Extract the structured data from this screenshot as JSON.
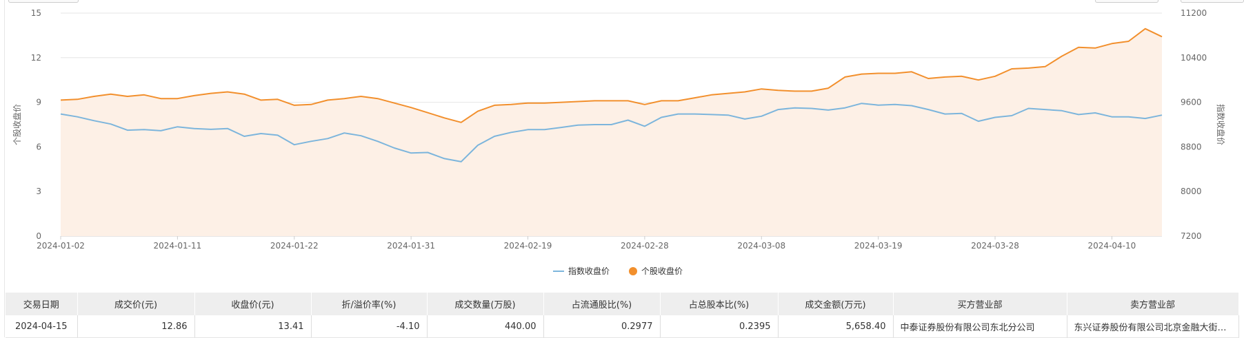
{
  "chart_data": {
    "type": "line",
    "x": [
      "2024-01-02",
      "2024-01-03",
      "2024-01-04",
      "2024-01-05",
      "2024-01-08",
      "2024-01-09",
      "2024-01-10",
      "2024-01-11",
      "2024-01-12",
      "2024-01-15",
      "2024-01-16",
      "2024-01-17",
      "2024-01-18",
      "2024-01-19",
      "2024-01-22",
      "2024-01-23",
      "2024-01-24",
      "2024-01-25",
      "2024-01-26",
      "2024-01-29",
      "2024-01-30",
      "2024-01-31",
      "2024-02-01",
      "2024-02-02",
      "2024-02-05",
      "2024-02-06",
      "2024-02-07",
      "2024-02-08",
      "2024-02-19",
      "2024-02-20",
      "2024-02-21",
      "2024-02-22",
      "2024-02-23",
      "2024-02-26",
      "2024-02-27",
      "2024-02-28",
      "2024-02-29",
      "2024-03-01",
      "2024-03-04",
      "2024-03-05",
      "2024-03-06",
      "2024-03-07",
      "2024-03-08",
      "2024-03-11",
      "2024-03-12",
      "2024-03-13",
      "2024-03-14",
      "2024-03-15",
      "2024-03-18",
      "2024-03-19",
      "2024-03-20",
      "2024-03-21",
      "2024-03-22",
      "2024-03-25",
      "2024-03-26",
      "2024-03-27",
      "2024-03-28",
      "2024-03-29",
      "2024-04-01",
      "2024-04-02",
      "2024-04-03",
      "2024-04-08",
      "2024-04-09",
      "2024-04-10",
      "2024-04-11",
      "2024-04-12",
      "2024-04-15"
    ],
    "x_ticks": [
      "2024-01-02",
      "2024-01-11",
      "2024-01-22",
      "2024-01-31",
      "2024-02-19",
      "2024-02-28",
      "2024-03-08",
      "2024-03-19",
      "2024-03-28",
      "2024-04-10"
    ],
    "series": [
      {
        "name": "指数收盘价",
        "axis": "right",
        "color": "#7cb5dc",
        "style": "line",
        "values": [
          9390,
          9340,
          9270,
          9210,
          9100,
          9110,
          9090,
          9160,
          9130,
          9115,
          9130,
          8990,
          9040,
          9010,
          8840,
          8900,
          8950,
          9050,
          9000,
          8900,
          8780,
          8690,
          8700,
          8590,
          8535,
          8830,
          8990,
          9060,
          9110,
          9110,
          9150,
          9190,
          9200,
          9200,
          9280,
          9170,
          9330,
          9390,
          9390,
          9380,
          9370,
          9300,
          9350,
          9470,
          9500,
          9490,
          9460,
          9500,
          9580,
          9550,
          9560,
          9540,
          9470,
          9390,
          9400,
          9260,
          9330,
          9360,
          9490,
          9470,
          9450,
          9380,
          9410,
          9340,
          9340,
          9310,
          9370
        ]
      },
      {
        "name": "个股收盘价",
        "axis": "left",
        "color": "#f28f2c",
        "fill": "#fdf0e6",
        "style": "area",
        "values": [
          9.15,
          9.2,
          9.4,
          9.55,
          9.4,
          9.5,
          9.25,
          9.25,
          9.45,
          9.6,
          9.7,
          9.55,
          9.15,
          9.2,
          8.8,
          8.85,
          9.15,
          9.25,
          9.4,
          9.25,
          8.95,
          8.65,
          8.3,
          7.95,
          7.65,
          8.4,
          8.8,
          8.85,
          8.95,
          8.95,
          9.0,
          9.05,
          9.1,
          9.1,
          9.1,
          8.85,
          9.1,
          9.1,
          9.3,
          9.5,
          9.6,
          9.7,
          9.9,
          9.8,
          9.75,
          9.75,
          9.95,
          10.7,
          10.9,
          10.95,
          10.95,
          11.05,
          10.6,
          10.7,
          10.75,
          10.5,
          10.75,
          11.25,
          11.3,
          11.4,
          12.1,
          12.7,
          12.65,
          12.95,
          13.1,
          13.95,
          13.41
        ]
      }
    ],
    "y_left": {
      "label": "个股收盘价",
      "range": [
        0,
        15
      ],
      "ticks": [
        0,
        3,
        6,
        9,
        12,
        15
      ]
    },
    "y_right": {
      "label": "指数收盘价",
      "range": [
        7200,
        11200
      ],
      "ticks": [
        7200,
        8000,
        8800,
        9600,
        10400,
        11200
      ]
    },
    "grid": true,
    "legend": {
      "position": "bottom-center",
      "items": [
        "指数收盘价",
        "个股收盘价"
      ]
    }
  },
  "table": {
    "headers": [
      "交易日期",
      "成交价(元)",
      "收盘价(元)",
      "折/溢价率(%)",
      "成交数量(万股)",
      "占流通股比(%)",
      "占总股本比(%)",
      "成交金额(万元)",
      "买方营业部",
      "卖方营业部"
    ],
    "rows": [
      [
        "2024-04-15",
        "12.86",
        "13.41",
        "-4.10",
        "440.00",
        "0.2977",
        "0.2395",
        "5,658.40",
        "中泰证券股份有限公司东北分公司",
        "东兴证券股份有限公司北京金融大街证券营业部"
      ]
    ]
  }
}
